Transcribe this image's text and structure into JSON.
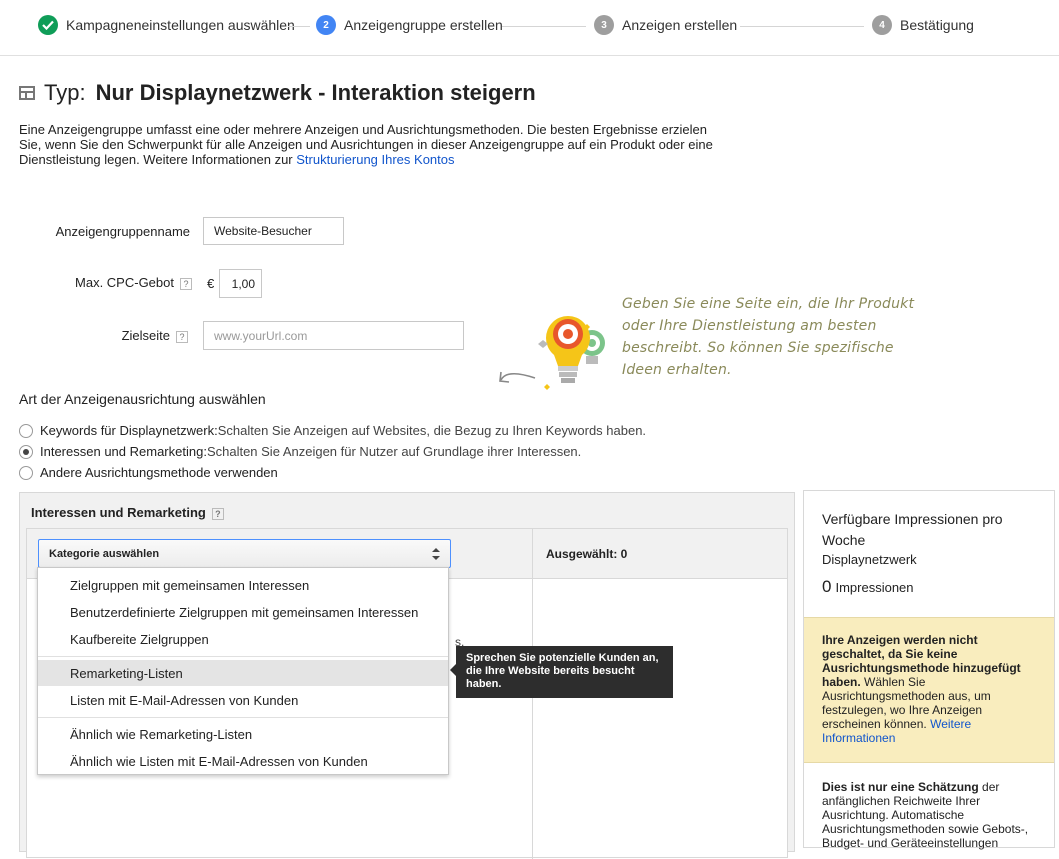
{
  "stepper": {
    "steps": [
      {
        "number": "",
        "label": "Kampagneneinstellungen auswählen",
        "state": "done"
      },
      {
        "number": "2",
        "label": "Anzeigengruppe erstellen",
        "state": "active"
      },
      {
        "number": "3",
        "label": "Anzeigen erstellen",
        "state": "todo"
      },
      {
        "number": "4",
        "label": "Bestätigung",
        "state": "todo"
      }
    ]
  },
  "header": {
    "title_prefix": "Typ:",
    "title": "Nur Displaynetzwerk - Interaktion steigern",
    "intro": "Eine Anzeigengruppe umfasst eine oder mehrere Anzeigen und Ausrichtungsmethoden. Die besten Ergebnisse erzielen Sie, wenn Sie den Schwerpunkt für alle Anzeigen und Ausrichtungen in dieser Anzeigengruppe auf ein Produkt oder eine Dienstleistung legen. Weitere Informationen zur ",
    "intro_link": "Strukturierung Ihres Kontos"
  },
  "form": {
    "adgroup_name_label": "Anzeigengruppenname",
    "adgroup_name_value": "Website-Besucher",
    "max_cpc_label": "Max. CPC-Gebot",
    "currency": "€",
    "max_cpc_value": "1,00",
    "landing_page_label": "Zielseite",
    "landing_page_placeholder": "www.yourUrl.com",
    "help_glyph": "?"
  },
  "hint": {
    "text": "Geben Sie eine Seite ein, die Ihr Produkt oder Ihre Dienstleistung am besten beschreibt. So können Sie spezifische Ideen erhalten."
  },
  "targeting": {
    "heading": "Art der Anzeigenausrichtung auswählen",
    "options": [
      {
        "label": "Keywords für Displaynetzwerk:",
        "desc": " Schalten Sie Anzeigen auf Websites, die Bezug zu Ihren Keywords haben.",
        "selected": false
      },
      {
        "label": "Interessen und Remarketing:",
        "desc": " Schalten Sie Anzeigen für Nutzer auf Grundlage ihrer Interessen.",
        "selected": true
      },
      {
        "label": "Andere Ausrichtungsmethode verwenden",
        "desc": "",
        "selected": false
      }
    ]
  },
  "interests": {
    "title": "Interessen und Remarketing",
    "select_label": "Kategorie auswählen",
    "selected_label": "Ausgewählt: 0",
    "hidden_fragment": "s.",
    "dropdown": [
      "Zielgruppen mit gemeinsamen Interessen",
      "Benutzerdefinierte Zielgruppen mit gemeinsamen Interessen",
      "Kaufbereite Zielgruppen",
      "Remarketing-Listen",
      "Listen mit E-Mail-Adressen von Kunden",
      "Ähnlich wie Remarketing-Listen",
      "Ähnlich wie Listen mit E-Mail-Adressen von Kunden"
    ],
    "highlighted_index": 3,
    "tooltip": "Sprechen Sie potenzielle Kunden an, die Ihre Website bereits besucht haben."
  },
  "sidebar": {
    "impressions_title": "Verfügbare Impressionen pro Woche",
    "network": "Displaynetzwerk",
    "count": "0",
    "count_unit": "Impressionen",
    "warning_bold": "Ihre Anzeigen werden nicht geschaltet, da Sie keine Ausrichtungsmethode hinzugefügt haben.",
    "warning_text": " Wählen Sie Ausrichtungsmethoden aus, um festzulegen, wo Ihre Anzeigen erscheinen können. ",
    "warning_link": "Weitere Informationen",
    "estimate_bold": "Dies ist nur eine Schätzung",
    "estimate_text": " der anfänglichen Reichweite Ihrer Ausrichtung. Automatische Ausrichtungsmethoden sowie Gebots-, Budget- und Geräteeinstellungen"
  },
  "colors": {
    "done": "#0f9d58",
    "active": "#4285f4",
    "todo": "#9e9e9e",
    "link": "#1155cc",
    "warning_bg": "#f9edbe",
    "bulb_yellow": "#f5c518",
    "bulb_green": "#7cc48a",
    "target_red": "#e8572b"
  }
}
